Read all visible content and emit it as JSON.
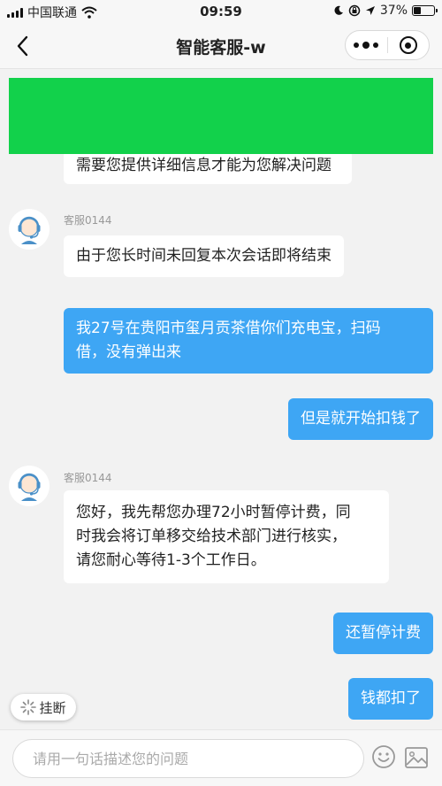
{
  "status_bar": {
    "carrier": "中国联通",
    "time": "09:59",
    "battery": "37%",
    "battery_level": 0.37
  },
  "nav": {
    "title": "智能客服-w"
  },
  "messages": [
    {
      "from": "agent",
      "text": "需要您提供详细信息才能为您解决问题"
    },
    {
      "from": "agent",
      "name": "客服0144",
      "text": "由于您长时间未回复本次会话即将结束"
    },
    {
      "from": "user",
      "lines": [
        "我27号在贵阳市玺月贡茶借你们充电宝，扫码",
        "借，没有弹出来"
      ]
    },
    {
      "from": "user",
      "text": "但是就开始扣钱了"
    },
    {
      "from": "agent",
      "name": "客服0144",
      "lines": [
        "您好，我先帮您办理72小时暂停计费，同",
        "时我会将订单移交给技术部门进行核实，",
        "请您耐心等待1-3个工作日。"
      ]
    },
    {
      "from": "user",
      "text": "还暂停计费"
    },
    {
      "from": "user",
      "text": "钱都扣了"
    }
  ],
  "hangup": {
    "label": "挂断"
  },
  "input": {
    "placeholder": "请用一句话描述您的问题"
  },
  "colors": {
    "banner": "#12d14b",
    "user_bubble": "#3ea6f4",
    "background": "#f2f2f2"
  }
}
